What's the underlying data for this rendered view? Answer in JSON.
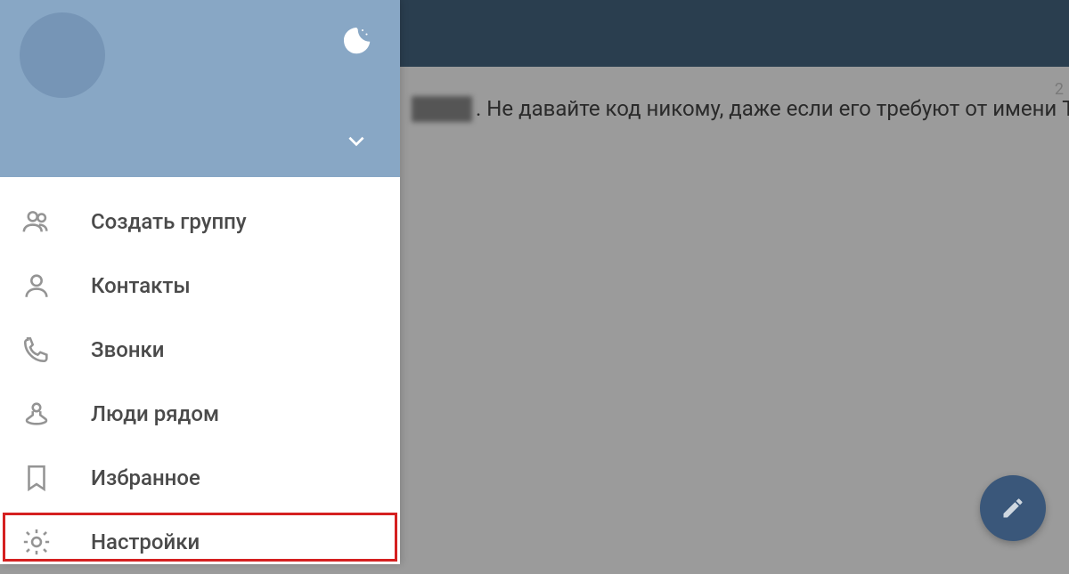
{
  "sidebar": {
    "menu": [
      {
        "label": "Создать группу",
        "icon": "group"
      },
      {
        "label": "Контакты",
        "icon": "person"
      },
      {
        "label": "Звонки",
        "icon": "phone"
      },
      {
        "label": "Люди рядом",
        "icon": "nearby"
      },
      {
        "label": "Избранное",
        "icon": "bookmark"
      },
      {
        "label": "Настройки",
        "icon": "gear"
      }
    ]
  },
  "chat": {
    "timestamp": "2",
    "message": ". Не давайте код никому, даже если его требуют от имени Telegram"
  }
}
